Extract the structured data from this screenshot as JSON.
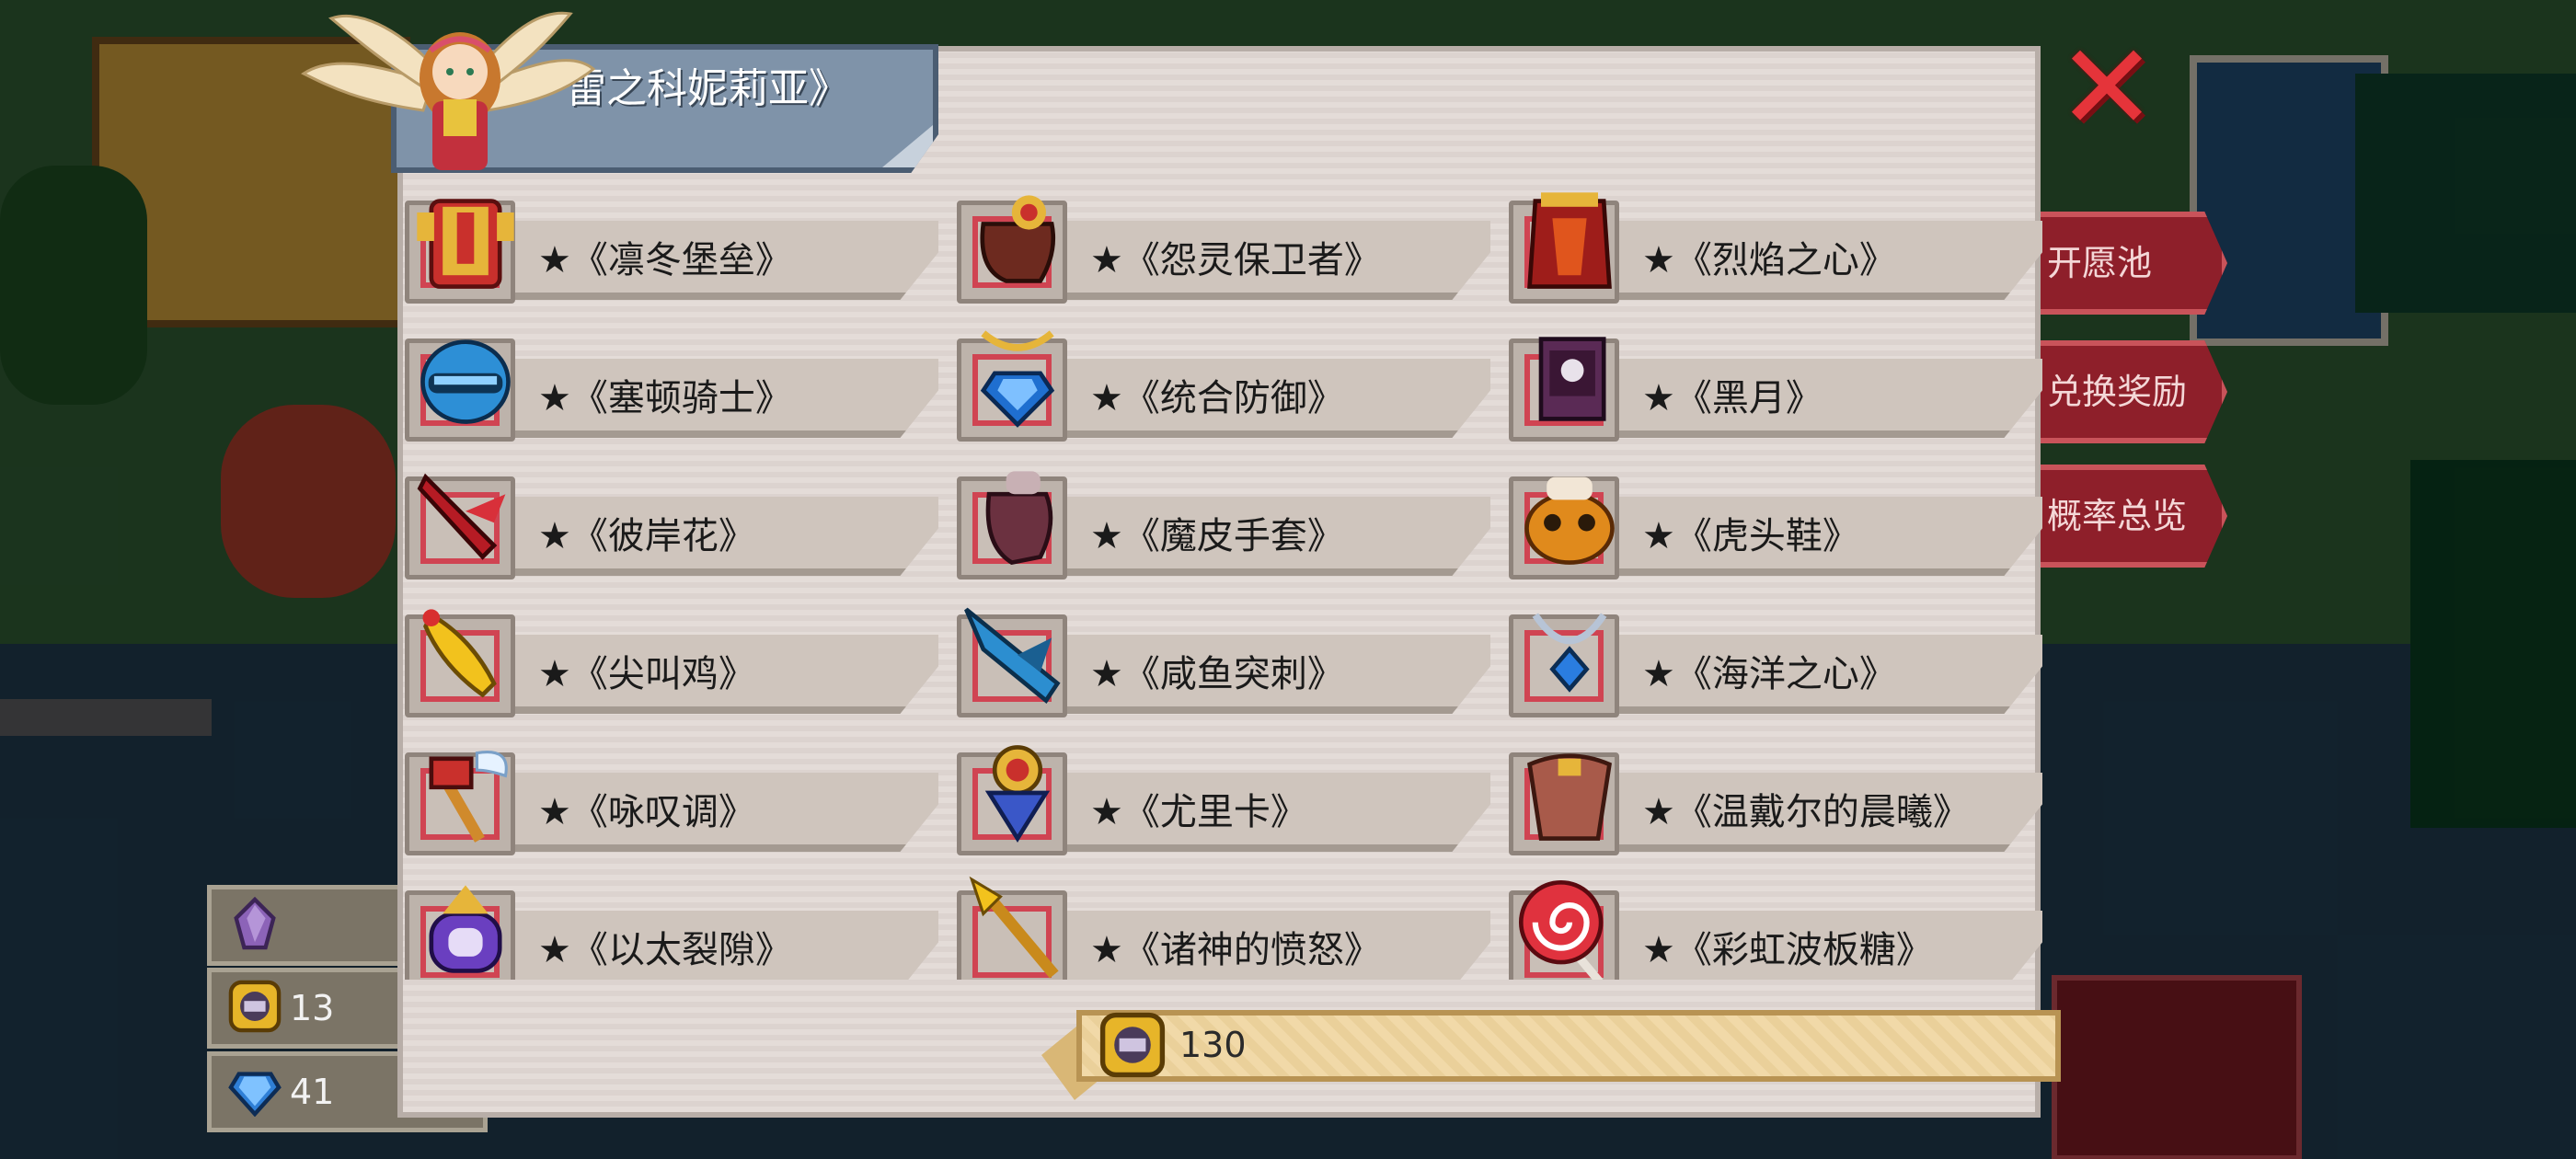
{
  "dialog": {
    "title": "雷之科妮莉亚》",
    "close_icon": "close-x-icon",
    "colors": {
      "accent_red": "#d04452",
      "title_tab": "#7f93a9",
      "panel": "#e4dcd8"
    }
  },
  "items": [
    {
      "name": "★《凛冬堡垒》",
      "icon": "winter-fortress-armor-icon"
    },
    {
      "name": "★《怨灵保卫者》",
      "icon": "wraith-guardian-glove-icon"
    },
    {
      "name": "★《烈焰之心》",
      "icon": "flame-heart-armor-icon"
    },
    {
      "name": "★《塞顿骑士》",
      "icon": "knight-helmet-icon"
    },
    {
      "name": "★《统合防御》",
      "icon": "blue-gem-amulet-icon"
    },
    {
      "name": "★《黑月》",
      "icon": "dark-book-icon"
    },
    {
      "name": "★《彼岸花》",
      "icon": "red-blade-icon"
    },
    {
      "name": "★《魔皮手套》",
      "icon": "demon-glove-icon"
    },
    {
      "name": "★《虎头鞋》",
      "icon": "tiger-shoe-icon"
    },
    {
      "name": "★《尖叫鸡》",
      "icon": "rubber-chicken-icon"
    },
    {
      "name": "★《咸鱼突刺》",
      "icon": "swordfish-icon"
    },
    {
      "name": "★《海洋之心》",
      "icon": "ocean-heart-necklace-icon"
    },
    {
      "name": "★《咏叹调》",
      "icon": "winged-hammer-icon"
    },
    {
      "name": "★《尤里卡》",
      "icon": "eureka-crest-icon"
    },
    {
      "name": "★《温戴尔的晨曦》",
      "icon": "wendel-cloak-icon"
    },
    {
      "name": "★《以太裂隙》",
      "icon": "ether-ring-icon"
    },
    {
      "name": "★《诸神的愤怒》",
      "icon": "golden-spear-icon"
    },
    {
      "name": "★《彩虹波板糖》",
      "icon": "lollipop-icon"
    }
  ],
  "cost": {
    "value": "130",
    "icon": "gacha-coin-icon"
  },
  "side_menu": [
    {
      "label": "开愿池"
    },
    {
      "label": "兑换奖励"
    },
    {
      "label": "概率总览"
    }
  ],
  "currencies": [
    {
      "icon": "purple-crystal-icon",
      "value": ""
    },
    {
      "icon": "gacha-coin-icon",
      "value": "13"
    },
    {
      "icon": "blue-gem-icon",
      "value": "41"
    }
  ]
}
